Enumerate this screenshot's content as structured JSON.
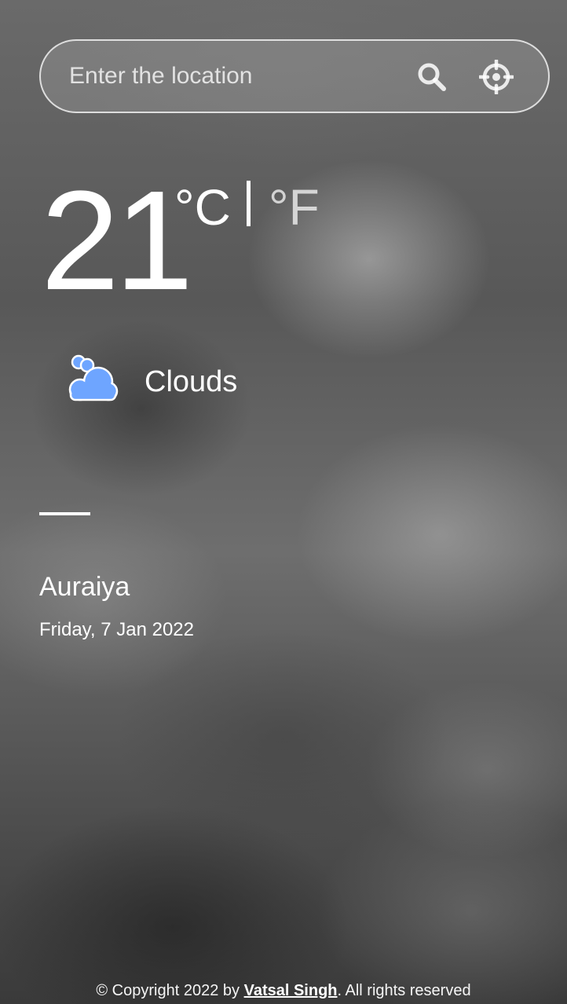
{
  "search": {
    "placeholder": "Enter the location",
    "value": "",
    "search_icon": "search-icon",
    "locate_icon": "crosshair-icon"
  },
  "weather": {
    "temperature": "21",
    "unit_celsius": "°C",
    "unit_separator": "|",
    "unit_fahrenheit": "°F",
    "condition": "Clouds",
    "condition_icon": "cloud-icon",
    "condition_icon_color": "#6ea5ff"
  },
  "location": {
    "city": "Auraiya",
    "date": "Friday, 7 Jan 2022"
  },
  "footer": {
    "prefix": "© Copyright 2022 by ",
    "author": "Vatsal Singh",
    "suffix": ". All rights reserved"
  }
}
